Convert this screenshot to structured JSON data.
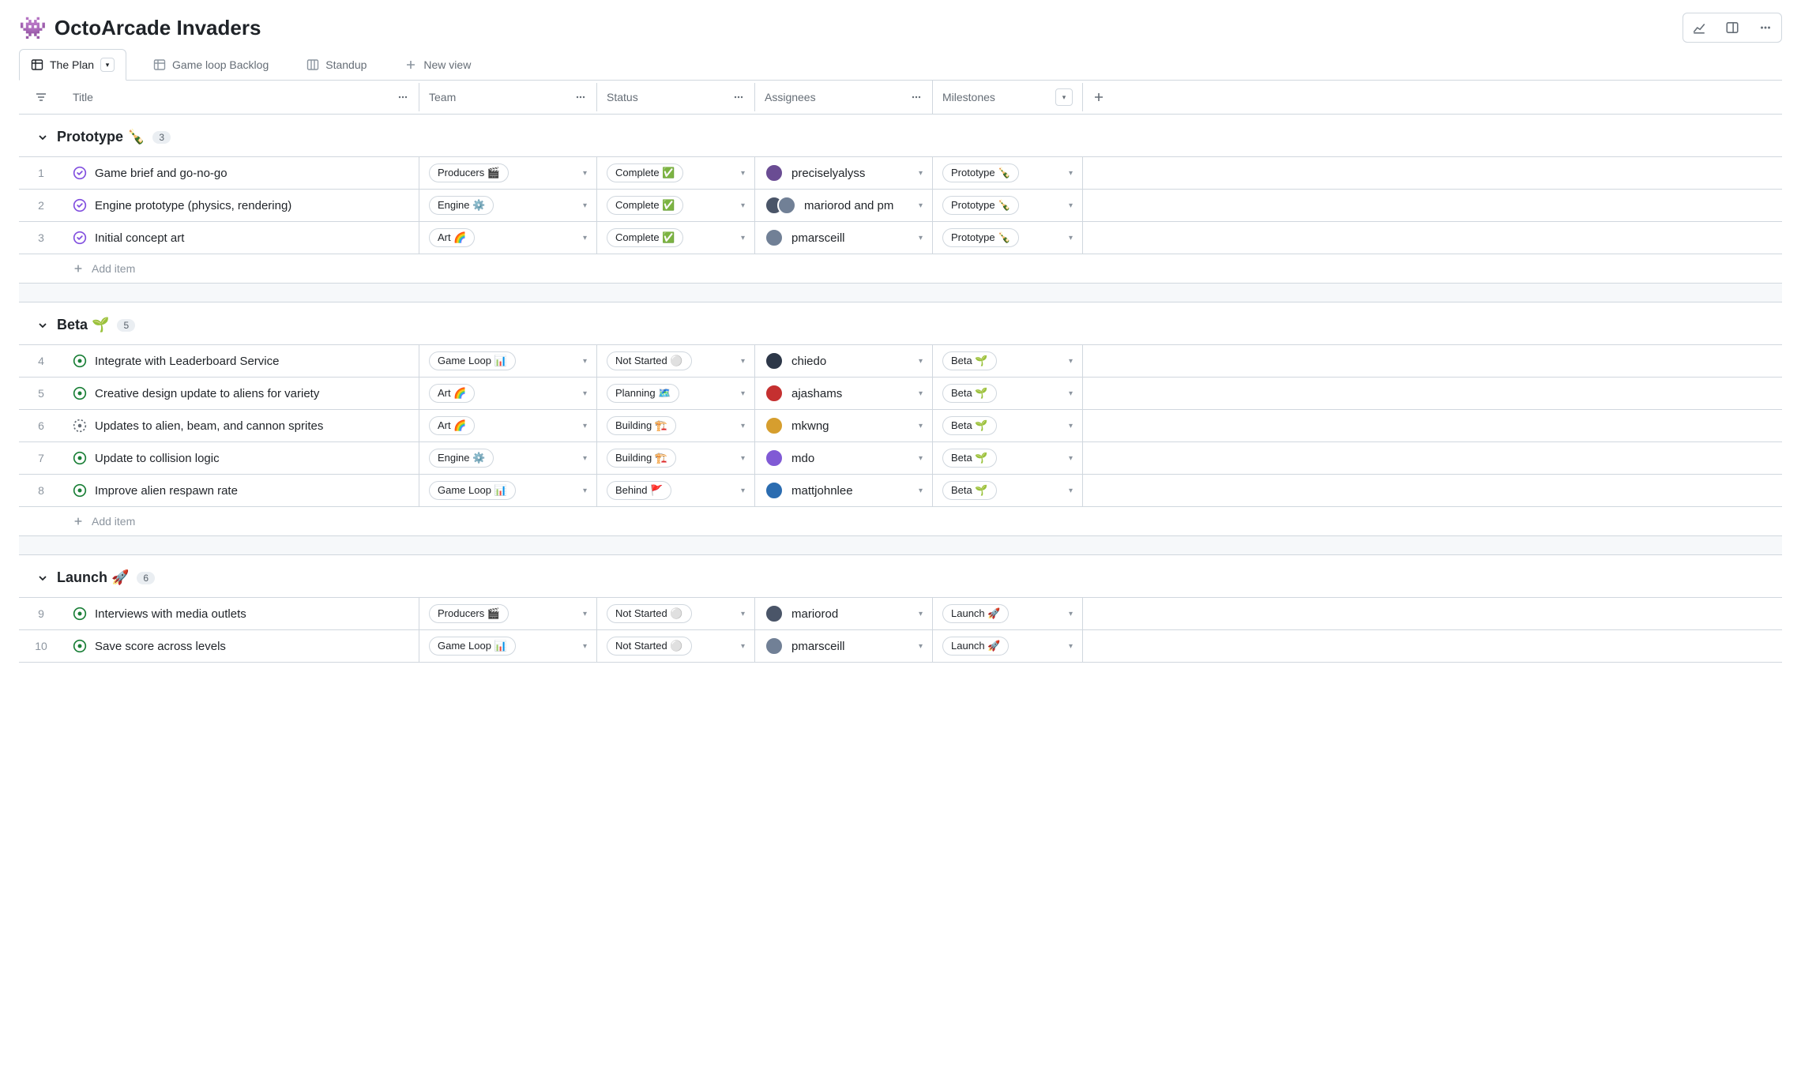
{
  "header": {
    "icon": "👾",
    "title": "OctoArcade Invaders"
  },
  "tabs": {
    "active": {
      "label": "The Plan"
    },
    "items": [
      {
        "label": "Game loop Backlog"
      },
      {
        "label": "Standup"
      }
    ],
    "new_view": "New view"
  },
  "columns": {
    "title": "Title",
    "team": "Team",
    "status": "Status",
    "assignees": "Assignees",
    "milestones": "Milestones"
  },
  "add_item_label": "Add item",
  "groups": [
    {
      "title": "Prototype 🍾",
      "count": "3",
      "rows": [
        {
          "num": "1",
          "icon": "closed",
          "title": "Game brief and go-no-go",
          "team": "Producers 🎬",
          "status": "Complete ✅",
          "assignees": "preciselyalyss",
          "avatars": [
            "av-a"
          ],
          "milestone": "Prototype 🍾"
        },
        {
          "num": "2",
          "icon": "closed",
          "title": "Engine prototype (physics, rendering)",
          "team": "Engine ⚙️",
          "status": "Complete ✅",
          "assignees": "mariorod and pm",
          "avatars": [
            "av-b",
            "av-c"
          ],
          "milestone": "Prototype 🍾"
        },
        {
          "num": "3",
          "icon": "closed",
          "title": "Initial concept art",
          "team": "Art 🌈",
          "status": "Complete ✅",
          "assignees": "pmarsceill",
          "avatars": [
            "av-c"
          ],
          "milestone": "Prototype 🍾"
        }
      ]
    },
    {
      "title": "Beta 🌱",
      "count": "5",
      "rows": [
        {
          "num": "4",
          "icon": "open",
          "title": "Integrate with Leaderboard Service",
          "team": "Game Loop 📊",
          "status": "Not Started ⚪",
          "assignees": "chiedo",
          "avatars": [
            "av-d"
          ],
          "milestone": "Beta 🌱"
        },
        {
          "num": "5",
          "icon": "open",
          "title": "Creative design update to aliens for variety",
          "team": "Art 🌈",
          "status": "Planning 🗺️",
          "assignees": "ajashams",
          "avatars": [
            "av-e"
          ],
          "milestone": "Beta 🌱"
        },
        {
          "num": "6",
          "icon": "draft",
          "title": "Updates to alien, beam, and cannon sprites",
          "team": "Art 🌈",
          "status": "Building 🏗️",
          "assignees": "mkwng",
          "avatars": [
            "av-f"
          ],
          "milestone": "Beta 🌱"
        },
        {
          "num": "7",
          "icon": "open",
          "title": "Update to collision logic",
          "team": "Engine ⚙️",
          "status": "Building 🏗️",
          "assignees": "mdo",
          "avatars": [
            "av-g"
          ],
          "milestone": "Beta 🌱"
        },
        {
          "num": "8",
          "icon": "open",
          "title": "Improve alien respawn rate",
          "team": "Game Loop 📊",
          "status": "Behind 🚩",
          "assignees": "mattjohnlee",
          "avatars": [
            "av-h"
          ],
          "milestone": "Beta 🌱"
        }
      ]
    },
    {
      "title": "Launch 🚀",
      "count": "6",
      "rows": [
        {
          "num": "9",
          "icon": "open",
          "title": "Interviews with media outlets",
          "team": "Producers 🎬",
          "status": "Not Started ⚪",
          "assignees": "mariorod",
          "avatars": [
            "av-b"
          ],
          "milestone": "Launch 🚀"
        },
        {
          "num": "10",
          "icon": "open",
          "title": "Save score across levels",
          "team": "Game Loop 📊",
          "status": "Not Started ⚪",
          "assignees": "pmarsceill",
          "avatars": [
            "av-c"
          ],
          "milestone": "Launch 🚀"
        }
      ]
    }
  ]
}
